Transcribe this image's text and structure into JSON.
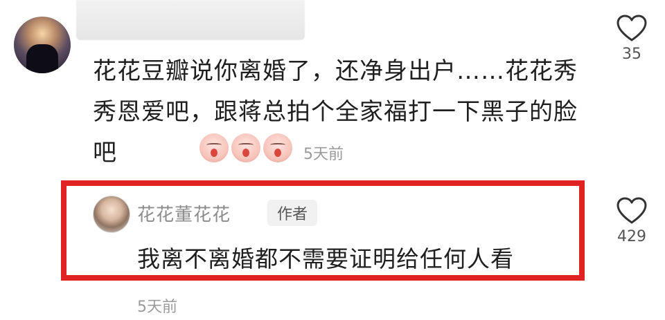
{
  "comment": {
    "text": "花花豆瓣说你离婚了，还净身出户……花花秀秀恩爱吧，跟蒋总拍个全家福打一下黑子的脸吧",
    "emojis": [
      "pig-face-icon",
      "pig-face-icon",
      "pig-face-icon"
    ],
    "time": "5天前",
    "likes": "35"
  },
  "reply": {
    "author": "花花董花花",
    "badge": "作者",
    "text": "我离不离婚都不需要证明给任何人看",
    "time": "5天前",
    "likes": "429"
  },
  "colors": {
    "highlight": "#e02222",
    "muted": "#9a9a9a"
  }
}
